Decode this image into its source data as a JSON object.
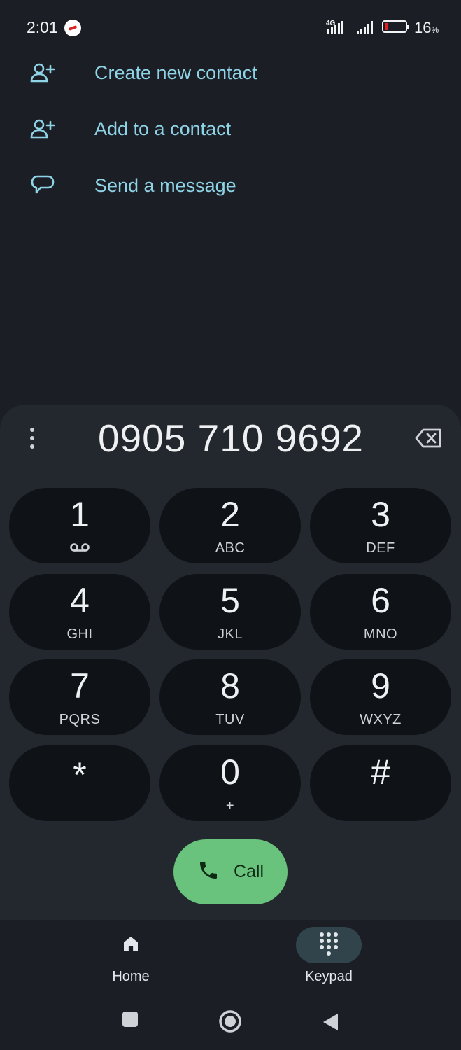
{
  "status_bar": {
    "time": "2:01",
    "network_type": "4G",
    "battery_percent": "16",
    "battery_unit": "%",
    "battery_level": 0.16,
    "battery_color": "#e02020"
  },
  "actions": [
    {
      "label": "Create new contact",
      "icon": "person-add-icon"
    },
    {
      "label": "Add to a contact",
      "icon": "person-add-icon"
    },
    {
      "label": "Send a message",
      "icon": "message-bubble-icon"
    }
  ],
  "dialer": {
    "number": "0905 710 9692",
    "keys": [
      {
        "digit": "1",
        "letters": "",
        "sub_icon": "voicemail-icon"
      },
      {
        "digit": "2",
        "letters": "ABC"
      },
      {
        "digit": "3",
        "letters": "DEF"
      },
      {
        "digit": "4",
        "letters": "GHI"
      },
      {
        "digit": "5",
        "letters": "JKL"
      },
      {
        "digit": "6",
        "letters": "MNO"
      },
      {
        "digit": "7",
        "letters": "PQRS"
      },
      {
        "digit": "8",
        "letters": "TUV"
      },
      {
        "digit": "9",
        "letters": "WXYZ"
      },
      {
        "digit": "*",
        "letters": ""
      },
      {
        "digit": "0",
        "letters": "+"
      },
      {
        "digit": "#",
        "letters": ""
      }
    ],
    "call_label": "Call",
    "call_color": "#6ac37c"
  },
  "bottom_nav": {
    "tabs": [
      {
        "label": "Home",
        "icon": "home-icon",
        "active": false
      },
      {
        "label": "Keypad",
        "icon": "dialpad-icon",
        "active": true
      }
    ]
  },
  "colors": {
    "accent": "#8fd3e6",
    "background": "#1b1f25",
    "sheet": "#23272e",
    "key": "#0f1317"
  }
}
